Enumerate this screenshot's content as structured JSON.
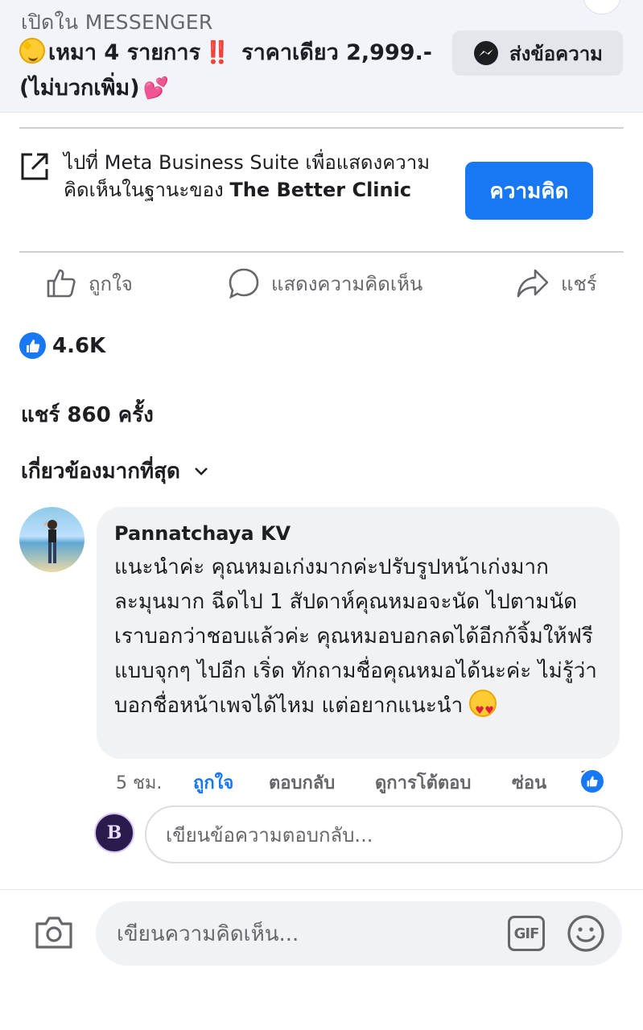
{
  "ad": {
    "open_in_label": "เปิดใน MESSENGER",
    "headline_part1": "เหมา 4 รายการ",
    "headline_bang": "‼️",
    "headline_part2": " ราคาเดียว 2,999.- (ไม่บวกเพิ่ม)",
    "headline_hearts": "💕",
    "send_message_label": "ส่งข้อความ"
  },
  "business_suite": {
    "text": "ไปที่ Meta Business Suite เพื่อแสดงความคิดเห็นในฐานะของ",
    "page_name": "The Better Clinic",
    "comment_button_label": "ความคิด"
  },
  "actions": {
    "like_label": "ถูกใจ",
    "comment_label": "แสดงความคิดเห็น",
    "share_label": "แชร์"
  },
  "stats": {
    "reaction_count": "4.6K",
    "shares_text": "แชร์ 860 ครั้ง"
  },
  "sort": {
    "label": "เกี่ยวข้องมากที่สุด"
  },
  "comment": {
    "author": "Pannatchaya KV",
    "text": "แนะนำค่ะ  คุณหมอเก่งมากค่ะปรับรูปหน้าเก่งมาก ละมุนมาก ฉีดไป 1 สัปดาห์คุณหมอจะนัด ไปตามนัด เราบอกว่าชอบแล้วค่ะ  คุณหมอบอกลดได้อีกก้จิ้มให้ฟรีแบบจุกๆ  ไปอีก เริ่ด  ทักถามชื่อคุณหมอได้นะค่ะ  ไม่รู้ว่าบอกชื่อหน้าเพจได้ไหม แต่อยากแนะนำ",
    "time": "5 ชม.",
    "like_label": "ถูกใจ",
    "reply_label": "ตอบกลับ",
    "view_replies_label": "ดูการโต้ตอบ",
    "hide_label": "ซ่อน",
    "like_count": "1"
  },
  "reply": {
    "page_avatar_initials": "B",
    "placeholder": "เขียนข้อความตอบกลับ..."
  },
  "composer": {
    "placeholder": "เขียนความคิดเห็น...",
    "gif_label": "GIF"
  },
  "colors": {
    "accent": "#1877f2",
    "text_primary": "#1c1e21",
    "text_secondary": "#65676b",
    "bubble_bg": "#f0f2f5"
  }
}
